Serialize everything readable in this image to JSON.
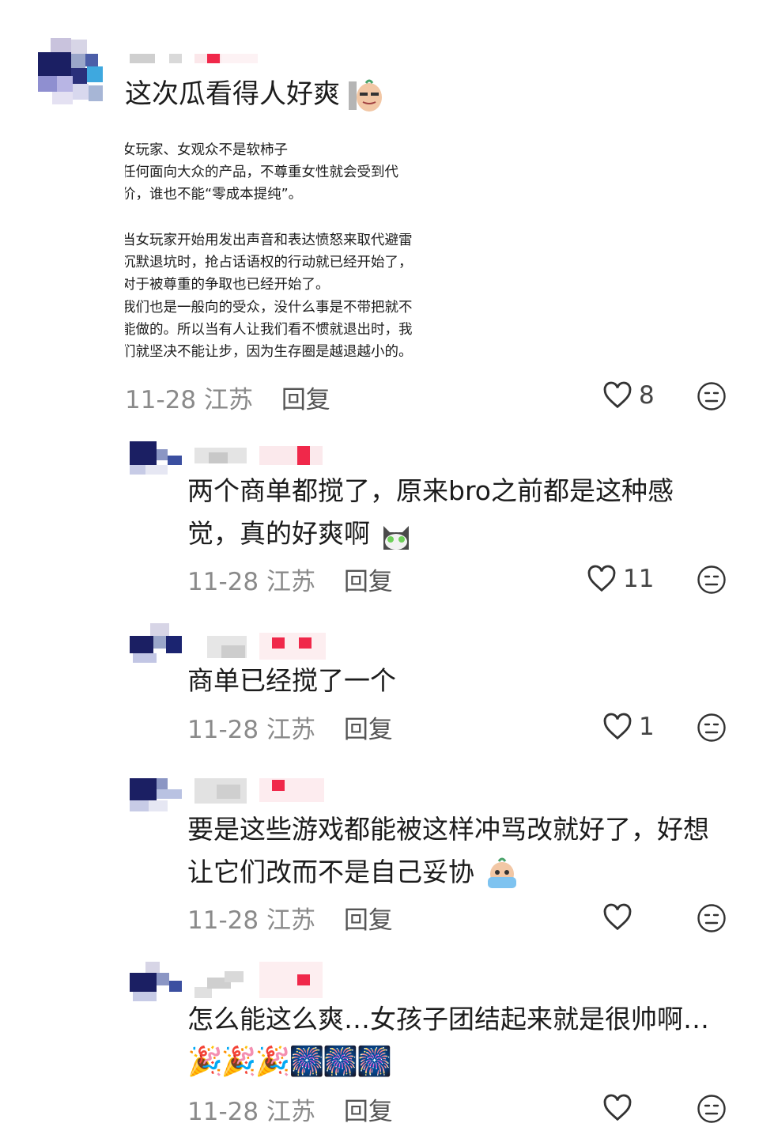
{
  "comments": [
    {
      "text": "这次瓜看得人好爽",
      "image_lines": [
        "女玩家、女观众不是软柿子",
        "任何面向大众的产品，不尊重女性就会受到代",
        "价，谁也不能“零成本提纯”。",
        "",
        "当女玩家开始用发出声音和表达愤怒来取代避雷",
        "沉默退坑时，抢占话语权的行动就已经开始了，",
        "对于被尊重的争取也已经开始了。",
        "我们也是一般向的受众，没什么事是不带把就不",
        "能做的。所以当有人让我们看不惯就退出时，我",
        "们就坚决不能让步，因为生存圈是越退越小的。"
      ],
      "date": "11-28",
      "location": "江苏",
      "reply": "回复",
      "likes": "8",
      "emoji": "sly-peanut-emoji"
    },
    {
      "line1": "两个商单都搅了，原来bro之前都是这种感",
      "line2": "觉，真的好爽啊",
      "date": "11-28",
      "location": "江苏",
      "reply": "回复",
      "likes": "11",
      "emoji": "cat-emoji"
    },
    {
      "line1": "商单已经搅了一个",
      "date": "11-28",
      "location": "江苏",
      "reply": "回复",
      "likes": "1"
    },
    {
      "line1": "要是这些游戏都能被这样冲骂改就好了，好想",
      "line2": "让它们改而不是自己妥协",
      "date": "11-28",
      "location": "江苏",
      "reply": "回复",
      "likes": "",
      "emoji": "crying-peanut-emoji"
    },
    {
      "line1": "怎么能这么爽…女孩子团结起来就是很帅啊…",
      "line2": "🎉🎉🎉🎆🎆🎆",
      "date": "11-28",
      "location": "江苏",
      "reply": "回复",
      "likes": ""
    }
  ],
  "colors": {
    "accent": "#f0284a",
    "meta": "#8a8a8a",
    "text": "#1c1c1c"
  }
}
